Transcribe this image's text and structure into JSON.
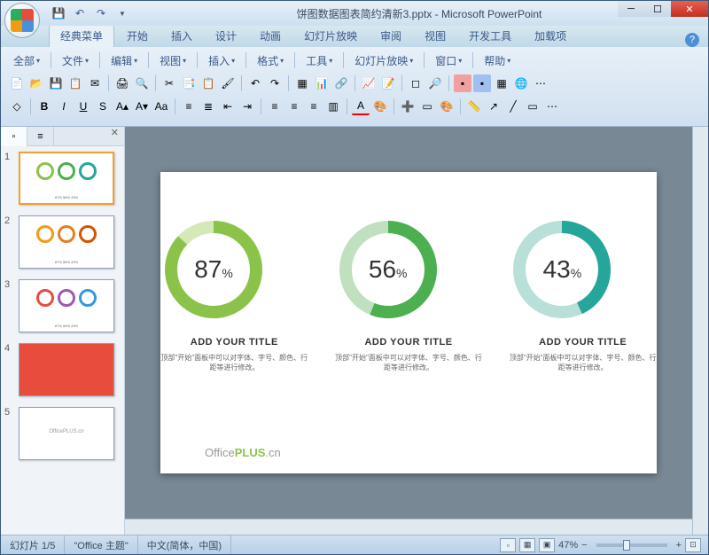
{
  "title": "饼图数据图表简约清新3.pptx - Microsoft PowerPoint",
  "ribbon_tabs": [
    "经典菜单",
    "开始",
    "插入",
    "设计",
    "动画",
    "幻灯片放映",
    "审阅",
    "视图",
    "开发工具",
    "加载项"
  ],
  "menu_bar": [
    "全部",
    "文件",
    "编辑",
    "视图",
    "插入",
    "格式",
    "工具",
    "幻灯片放映",
    "窗口",
    "帮助"
  ],
  "slides": {
    "count": 5
  },
  "chart_data": {
    "type": "pie",
    "series": [
      {
        "name": "ADD YOUR TITLE",
        "value": 87,
        "color": "#8bc34a",
        "bg": "#d4e8b8"
      },
      {
        "name": "ADD YOUR TITLE",
        "value": 56,
        "color": "#4caf50",
        "bg": "#c0e0c0"
      },
      {
        "name": "ADD YOUR TITLE",
        "value": 43,
        "color": "#26a69a",
        "bg": "#b8e0d8"
      }
    ],
    "desc": "顶部\"开始\"面板中可以对字体、字号、颜色、行距等进行修改。"
  },
  "brand": {
    "prefix": "Office",
    "mid": "PLUS",
    "suffix": ".cn"
  },
  "status": {
    "slide": "幻灯片 1/5",
    "theme": "\"Office 主题\"",
    "lang": "中文(简体，中国)",
    "zoom": "47%"
  }
}
